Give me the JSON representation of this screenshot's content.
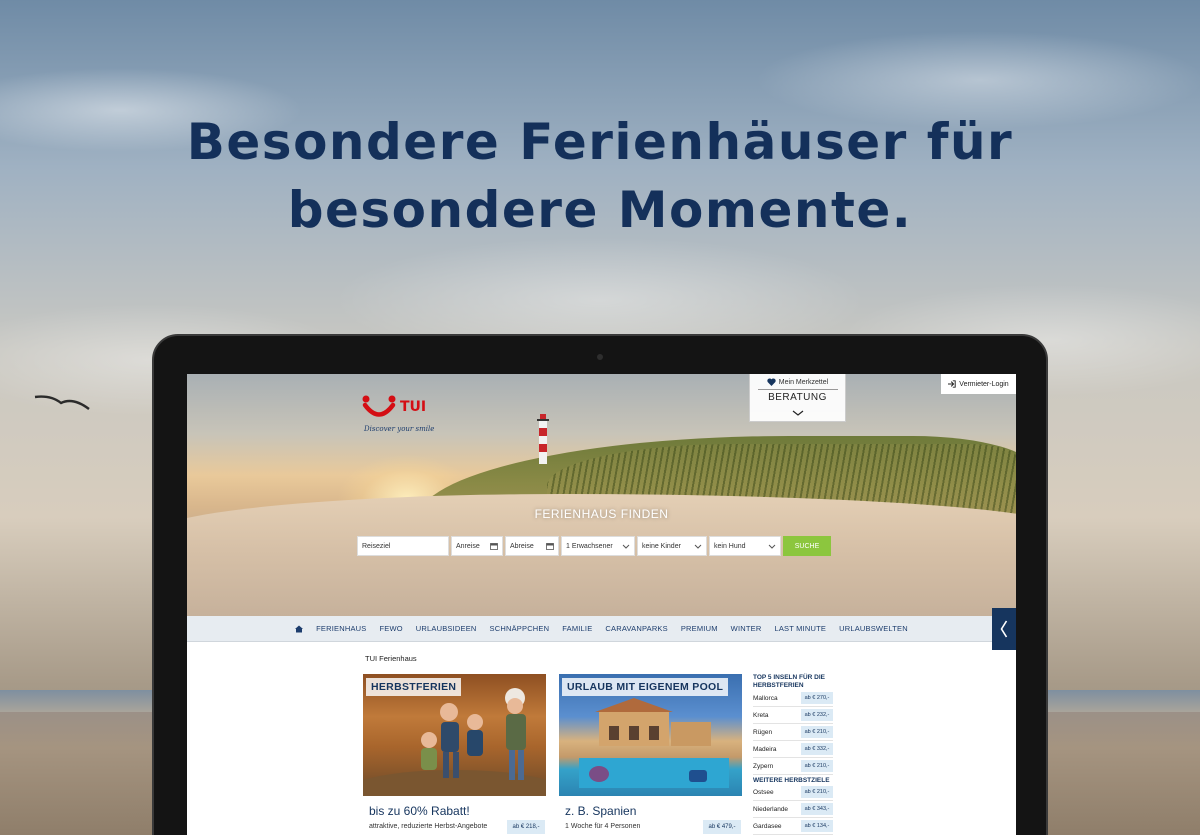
{
  "headline": {
    "line1": "Besondere Ferienhäuser für",
    "line2": "besondere Momente."
  },
  "site": {
    "logo_text": "TUI",
    "tagline": "Discover your smile",
    "merkzettel": "Mein Merkzettel",
    "beratung": "BERATUNG",
    "vermieter_login": "Vermieter-Login",
    "search": {
      "title": "FERIENHAUS FINDEN",
      "destination_placeholder": "Reiseziel",
      "arrival": "Anreise",
      "departure": "Abreise",
      "adults": "1 Erwachsener",
      "children": "keine Kinder",
      "dog": "kein Hund",
      "submit": "SUCHE"
    },
    "nav": [
      "FERIENHAUS",
      "FEWO",
      "URLAUBSIDEEN",
      "SCHNÄPPCHEN",
      "FAMILIE",
      "CARAVANPARKS",
      "PREMIUM",
      "WINTER",
      "LAST MINUTE",
      "URLAUBSWELTEN"
    ],
    "breadcrumb": "TUI Ferienhaus",
    "cards": [
      {
        "tag": "HERBSTFERIEN",
        "headline": "bis zu 60% Rabatt!",
        "sub": "attraktive, reduzierte Herbst-Angebote",
        "price": "ab € 218,-"
      },
      {
        "tag": "URLAUB MIT EIGENEM POOL",
        "headline": "z. B. Spanien",
        "sub": "1 Woche für 4 Personen",
        "price": "ab € 479,-"
      }
    ],
    "sidebar": {
      "title": "TOP 5 INSELN FÜR DIE HERBSTFERIEN",
      "islands": [
        {
          "name": "Mallorca",
          "price": "ab € 270,-"
        },
        {
          "name": "Kreta",
          "price": "ab € 232,-"
        },
        {
          "name": "Rügen",
          "price": "ab € 210,-"
        },
        {
          "name": "Madeira",
          "price": "ab € 332,-"
        },
        {
          "name": "Zypern",
          "price": "ab € 210,-"
        }
      ],
      "more_title": "WEITERE HERBSTZIELE",
      "more": [
        {
          "name": "Ostsee",
          "price": "ab € 210,-"
        },
        {
          "name": "Niederlande",
          "price": "ab € 343,-"
        },
        {
          "name": "Gardasee",
          "price": "ab € 134,-"
        }
      ]
    }
  },
  "colors": {
    "headline": "#14305a",
    "brand_red": "#d40e14",
    "navy": "#16355e",
    "search_button": "#8cc63e"
  }
}
